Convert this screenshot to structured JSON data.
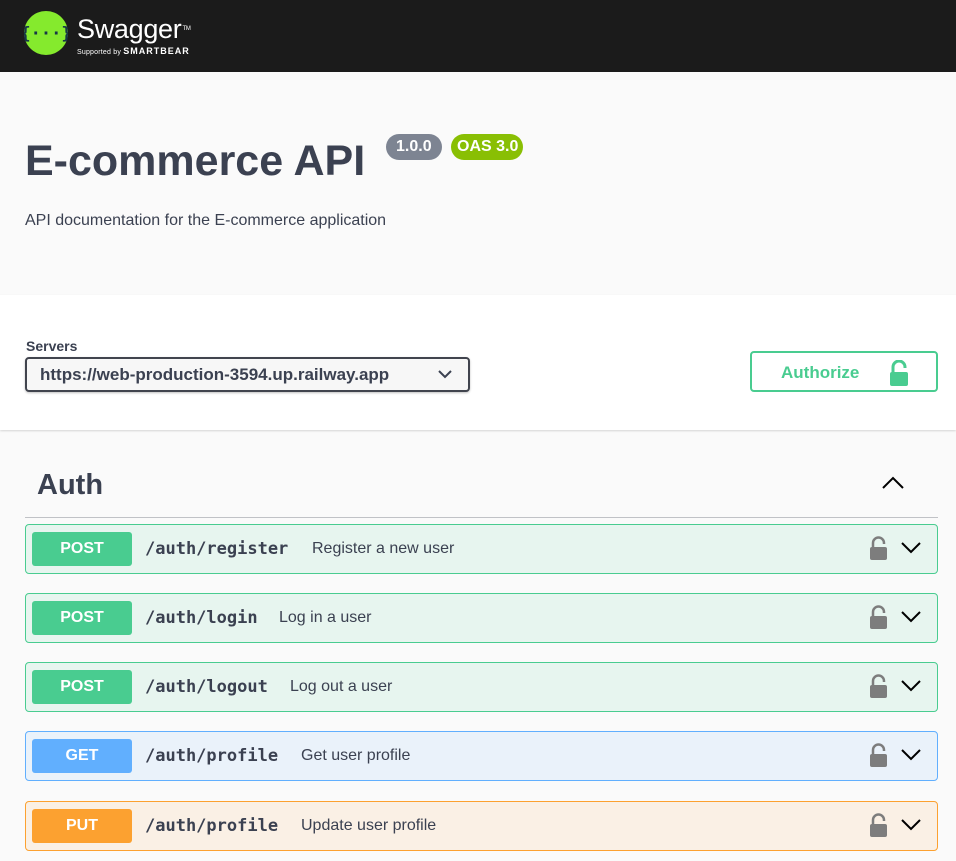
{
  "topbar": {
    "brand_name": "Swagger",
    "brand_tm": "TM",
    "supported_by": "Supported by",
    "smartbear": "SMARTBEAR"
  },
  "info": {
    "title": "E-commerce API",
    "version": "1.0.0",
    "oas": "OAS 3.0",
    "description": "API documentation for the E-commerce application"
  },
  "servers": {
    "label": "Servers",
    "selected": "https://web-production-3594.up.railway.app"
  },
  "authorize": {
    "label": "Authorize"
  },
  "tag": {
    "name": "Auth"
  },
  "operations": [
    {
      "method": "POST",
      "path": "/auth/register",
      "summary": "Register a new user"
    },
    {
      "method": "POST",
      "path": "/auth/login",
      "summary": "Log in a user"
    },
    {
      "method": "POST",
      "path": "/auth/logout",
      "summary": "Log out a user"
    },
    {
      "method": "GET",
      "path": "/auth/profile",
      "summary": "Get user profile"
    },
    {
      "method": "PUT",
      "path": "/auth/profile",
      "summary": "Update user profile"
    }
  ],
  "colors": {
    "post": "#49cc90",
    "get": "#61affe",
    "put": "#fca130",
    "topbar": "#1b1b1b",
    "logo_green": "#85ea2d"
  }
}
